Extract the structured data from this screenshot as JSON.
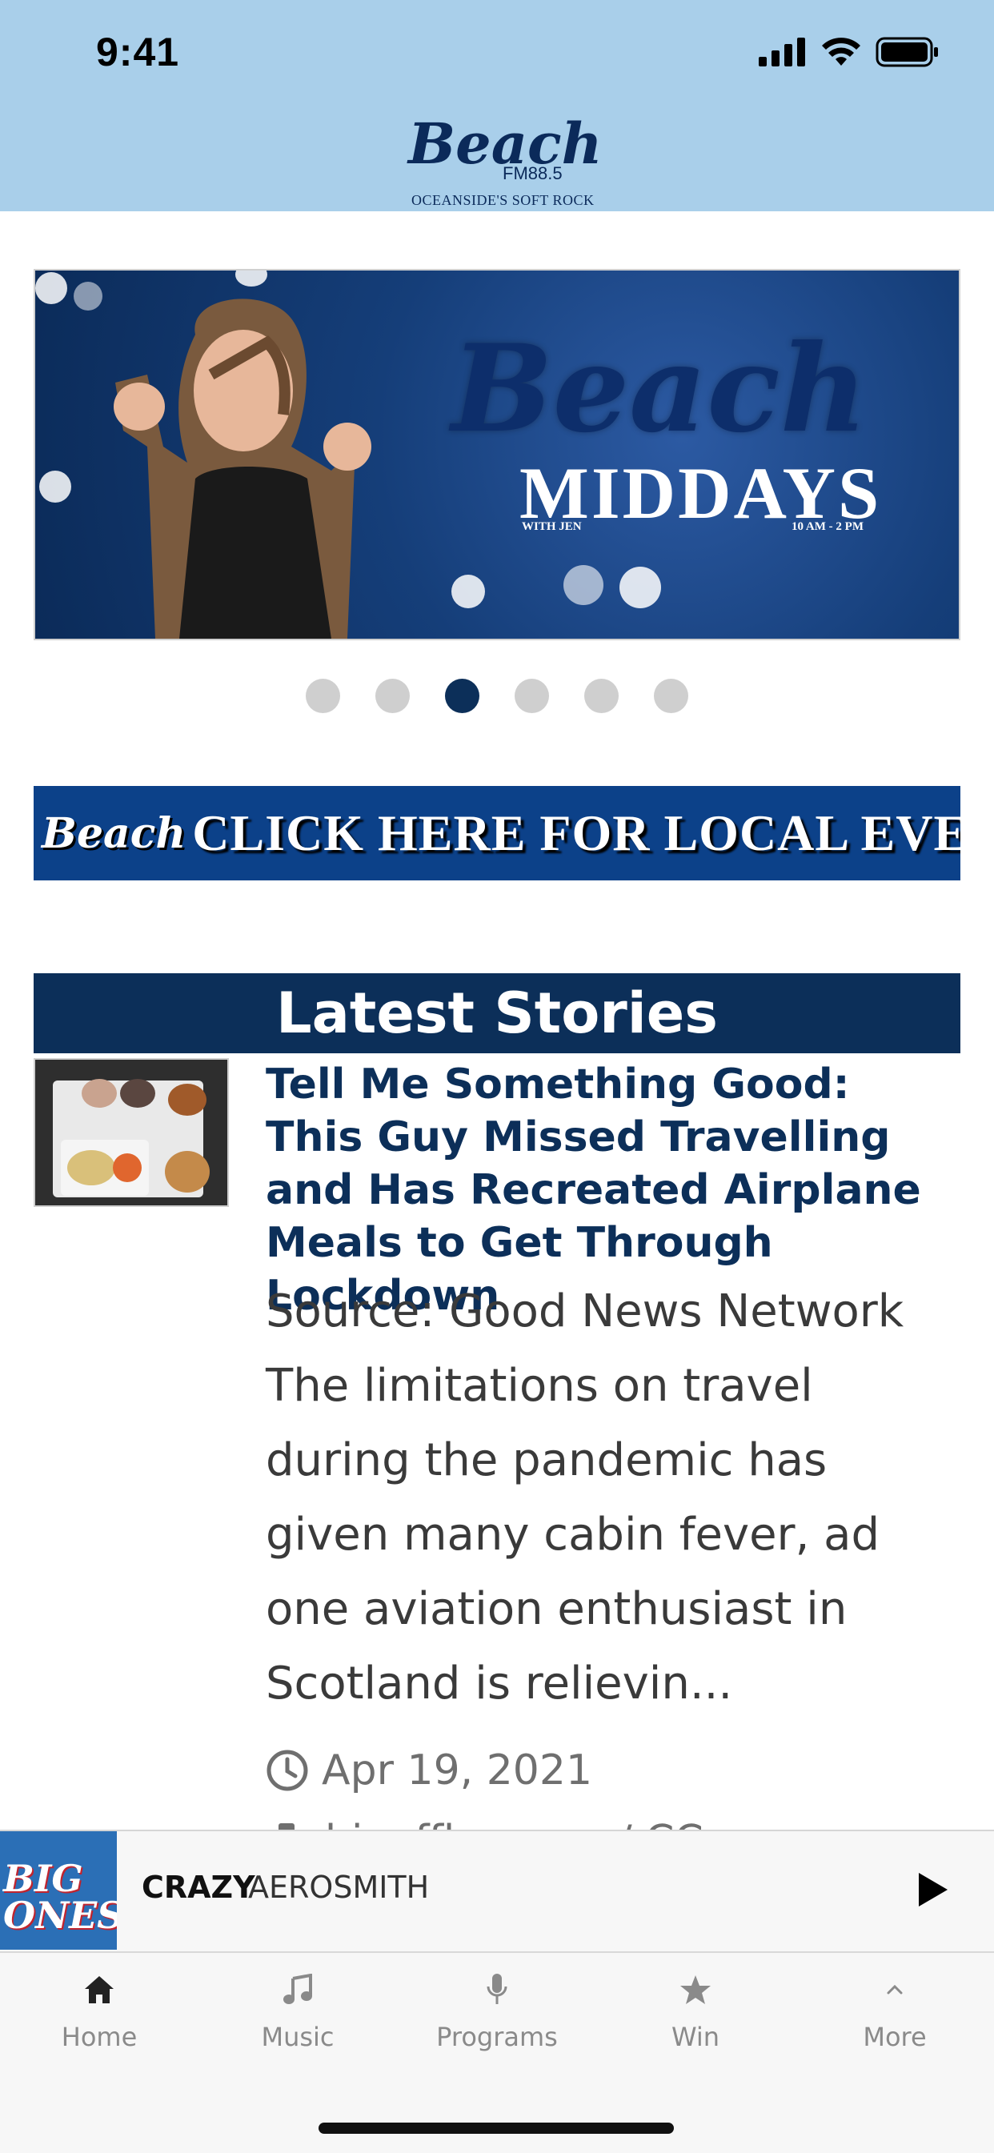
{
  "status_bar": {
    "time": "9:41"
  },
  "header": {
    "logo_script": "Beach",
    "logo_fm": "FM88.5",
    "logo_tagline": "OCEANSIDE'S SOFT ROCK"
  },
  "hero_banner": {
    "script_text": "Beach",
    "title": "MIDDAYS",
    "with": "WITH JEN",
    "hours": "10 AM - 2 PM"
  },
  "carousel": {
    "count": 6,
    "active_index": 2
  },
  "events_banner": {
    "mini_logo": "Beach",
    "text": "CLICK HERE FOR LOCAL EVENTS"
  },
  "latest": {
    "heading": "Latest Stories"
  },
  "story": {
    "title": "Tell Me Something Good: This Guy Missed Travelling and Has Recreated Airplane Meals to Get Through Lockdown",
    "excerpt": "Source: Good News Network The limitations on travel during the pandemic has given many cabin fever, ad one aviation enthusiast in Scotland is relievin...",
    "date": "Apr 19, 2021",
    "byline_partial": "hinoffhamm…/ CC"
  },
  "now_playing": {
    "art_text": "BIG ONES",
    "song": "CRAZY",
    "artist": "AEROSMITH"
  },
  "tabs": [
    {
      "label": "Home",
      "icon": "home-icon"
    },
    {
      "label": "Music",
      "icon": "music-icon"
    },
    {
      "label": "Programs",
      "icon": "microphone-icon"
    },
    {
      "label": "Win",
      "icon": "star-icon"
    },
    {
      "label": "More",
      "icon": "chevron-up-icon"
    }
  ],
  "colors": {
    "header_bg": "#a9cfea",
    "navy": "#0c2f59",
    "events_blue": "#0c4189"
  }
}
